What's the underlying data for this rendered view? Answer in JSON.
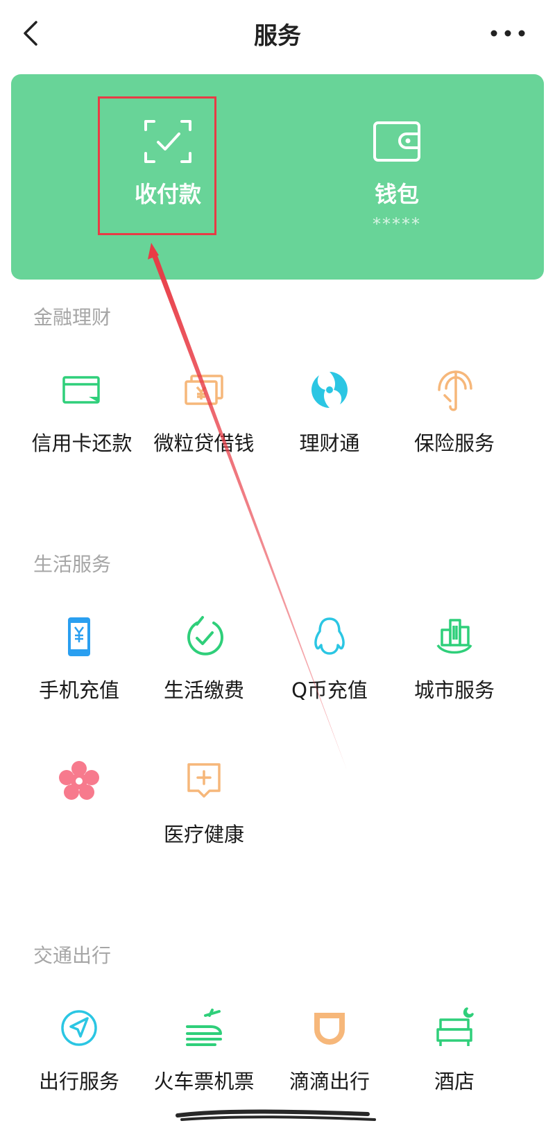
{
  "nav": {
    "title": "服务"
  },
  "wallet_card": {
    "pay": {
      "label": "收付款"
    },
    "wallet": {
      "label": "钱包",
      "balance_masked": "*****"
    }
  },
  "sections": {
    "finance": {
      "title": "金融理财",
      "items": [
        {
          "label": "信用卡还款",
          "icon": "credit-card-icon"
        },
        {
          "label": "微粒贷借钱",
          "icon": "loan-icon"
        },
        {
          "label": "理财通",
          "icon": "wealth-icon"
        },
        {
          "label": "保险服务",
          "icon": "insurance-icon"
        }
      ]
    },
    "life": {
      "title": "生活服务",
      "items": [
        {
          "label": "手机充值",
          "icon": "phone-recharge-icon"
        },
        {
          "label": "生活缴费",
          "icon": "bill-payment-icon"
        },
        {
          "label": "Q币充值",
          "icon": "qq-penguin-icon"
        },
        {
          "label": "城市服务",
          "icon": "city-service-icon"
        },
        {
          "label": "",
          "icon": "flower-icon"
        },
        {
          "label": "医疗健康",
          "icon": "medical-icon"
        }
      ]
    },
    "transport": {
      "title": "交通出行",
      "items": [
        {
          "label": "出行服务",
          "icon": "travel-service-icon"
        },
        {
          "label": "火车票机票",
          "icon": "train-ticket-icon"
        },
        {
          "label": "滴滴出行",
          "icon": "didi-icon"
        },
        {
          "label": "酒店",
          "icon": "hotel-icon"
        }
      ]
    }
  },
  "colors": {
    "card_green": "#68d498",
    "highlight_red": "#e83b45",
    "icon_green": "#2fcf7a",
    "icon_orange": "#f6b77a",
    "icon_cyan": "#2bc6e3",
    "icon_blue": "#2a9ff0",
    "icon_pink": "#f77a8d"
  }
}
